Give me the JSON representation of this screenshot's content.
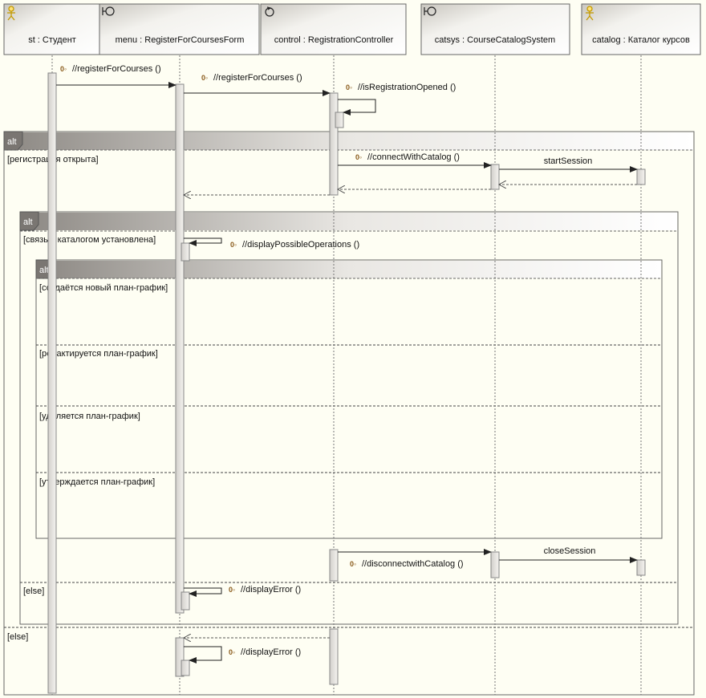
{
  "lifelines": [
    {
      "id": "st",
      "label": "st : Студент",
      "icon": "actor-icon"
    },
    {
      "id": "menu",
      "label": "menu : RegisterForCoursesForm",
      "icon": "boundary-icon"
    },
    {
      "id": "control",
      "label": "control : RegistrationController",
      "icon": "control-icon"
    },
    {
      "id": "catsys",
      "label": "catsys : CourseCatalogSystem",
      "icon": "boundary-icon"
    },
    {
      "id": "catalog",
      "label": "catalog : Каталог курсов",
      "icon": "actor-icon"
    }
  ],
  "fragments": {
    "outer": {
      "operator": "alt",
      "guard1": "[регистрация открыта]",
      "guard2": "[else]"
    },
    "middle": {
      "operator": "alt",
      "guard1": "[связь с каталогом установлена]",
      "guard2": "[else]"
    },
    "inner": {
      "operator": "alt",
      "guards": [
        "[создаётся новый план-график]",
        "[редактируется план-график]",
        "[удаляется план-график]",
        "[утверждается план-график]"
      ]
    }
  },
  "messages": [
    {
      "id": "m1",
      "label": "//registerForCourses ()",
      "op_badge": true
    },
    {
      "id": "m2",
      "label": "//registerForCourses ()",
      "op_badge": true
    },
    {
      "id": "m3",
      "label": "//isRegistrationOpened ()",
      "op_badge": true
    },
    {
      "id": "m4",
      "label": "//connectWithCatalog ()",
      "op_badge": true
    },
    {
      "id": "m5",
      "label": "startSession",
      "op_badge": false
    },
    {
      "id": "m6",
      "label": "//displayPossibleOperations ()",
      "op_badge": true
    },
    {
      "id": "m7",
      "label": "//disconnectwithCatalog ()",
      "op_badge": true
    },
    {
      "id": "m8",
      "label": "closeSession",
      "op_badge": false
    },
    {
      "id": "m9",
      "label": "//displayError ()",
      "op_badge": true
    },
    {
      "id": "m10",
      "label": "//displayError ()",
      "op_badge": true
    }
  ],
  "op_badge_text": "0◦",
  "colors": {
    "background": "#fefef3",
    "header_fill": "#ecebe6",
    "activation_fill": "#e5e3df",
    "fragment_tab": "#7a7672",
    "line": "#333333"
  }
}
